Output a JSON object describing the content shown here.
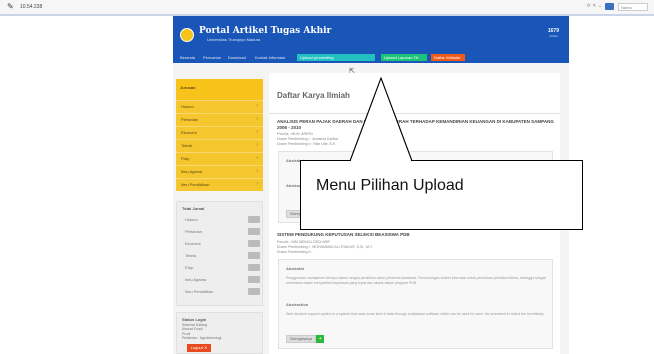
{
  "browser": {
    "url": "10.54.238",
    "tab_label": "Nama"
  },
  "header": {
    "title": "Portal Artikel Tugas Akhir",
    "subtitle": "Universitas Trunojoyo Madura",
    "counter_value": "1679",
    "counter_label": "Artikel"
  },
  "menu": {
    "items": [
      "Beranda",
      "Pencarian",
      "Download",
      "Kontak Informasi"
    ],
    "buttons": [
      "Upload proceeding",
      "Upload Laporan TA",
      "Daftar Website"
    ]
  },
  "sidebar": {
    "heading": "Jurusan",
    "categories": [
      "Hukum",
      "Pertanian",
      "Ekonomi",
      "Teknik",
      "Fisip",
      "Ilmu Agama",
      "Ilmu Pendidikan"
    ],
    "stats_title": "Total Jurnal",
    "stats_items": [
      "Hukum",
      "Pertanian",
      "Ekonomi",
      "Teknik",
      "Fisip",
      "Ilmu Agama",
      "Ilmu Pendidikan"
    ],
    "login_title": "Status Login",
    "login_lines": [
      "Selamat Datang",
      "Ahmad Fuadi",
      "Prodi",
      "Pertanian - Agroteknologi"
    ],
    "logout_label": "Logout"
  },
  "content": {
    "title": "Daftar Karya Ilmiah",
    "item1_title": "ANALISIS PERAN PAJAK DAERAH DAN RETRIBUSI DAERAH TERHADAP KEMANDIRIAN KEUANGAN DI KABUPATEN SAMPANG 2006 - 2010",
    "item1_meta": [
      "Penulis : MUH. ARIFIN",
      "Dosen Pembimbing I : Andarisa Kartika",
      "Dosen Pembimbing II : Rike Ufie, S.E."
    ],
    "item1_label_a": "Abstraksi",
    "item1_label_b": "Abstract",
    "item1_button": "Selengkapnya",
    "item2_title": "SISTEM PENDUKUNG KEPUTUSAN SELEKSI BEASISWA PDB",
    "item2_meta": [
      "Penulis : NIM 0800411 DEDI ARIF",
      "Dosen Pembimbing I : MOHAMMAD ALI SYAKUR, S.Si., M.T.",
      "Dosen Pembimbing II : -"
    ],
    "item2_label_a": "Abstraksi",
    "item2_text_a": "Penggunaan manajemen berupa sistem rangka pemilihan calon penerima beasiswa. Pendukungan sistem informasi untuk penentuan prioritas kriteria, sehingga sangat membantu dalam menyeleksi keputusan yang tepat dan akurat dalam program PDB.",
    "item2_label_b": "Abstraction",
    "item2_text_b": "Web decision support system is a system that uses some kind of data through a database software which can be used for each, the prominent to select the beneficiary.",
    "item2_button": "Selengkapnya"
  },
  "annotation": {
    "callout_text": "Menu Pilihan Upload"
  }
}
